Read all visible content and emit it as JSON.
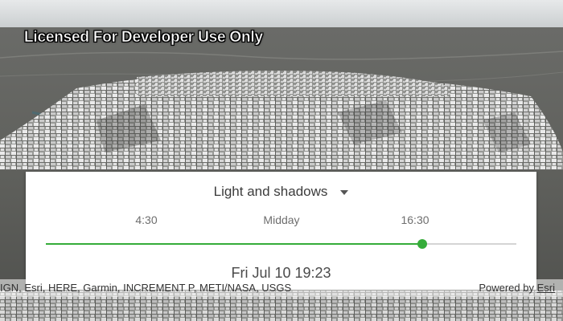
{
  "watermark": "Licensed For Developer Use Only",
  "panel": {
    "mode_label": "Light and shadows",
    "mode_caret_icon": "caret-down-icon",
    "ticks": [
      "4:30",
      "Midday",
      "16:30"
    ],
    "slider_accent": "#35ac3a",
    "slider_value": 0.8,
    "date_time": "Fri Jul 10 19:23"
  },
  "attribution": {
    "sources": "IGN, Esri, HERE, Garmin, INCREMENT P, METI/NASA, USGS",
    "powered_prefix": "Powered by",
    "powered_link": "Esri"
  }
}
